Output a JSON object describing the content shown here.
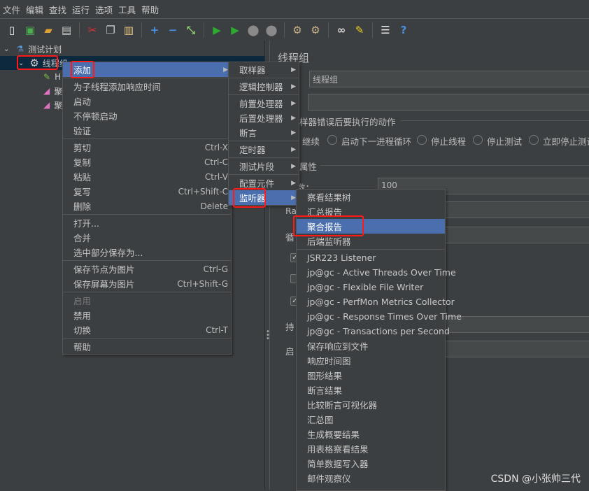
{
  "menubar": [
    "文件",
    "编辑",
    "查找",
    "运行",
    "选项",
    "工具",
    "帮助"
  ],
  "toolbar": [
    {
      "icon": "new-icon",
      "glyph": "▯",
      "color": "#eeeeee"
    },
    {
      "icon": "templates-icon",
      "glyph": "▣",
      "color": "#4caf50"
    },
    {
      "icon": "open-icon",
      "glyph": "▰",
      "color": "#e0a030"
    },
    {
      "icon": "save-icon",
      "glyph": "▤",
      "color": "#cccccc"
    },
    {
      "sep": true
    },
    {
      "icon": "cut-icon",
      "glyph": "✂",
      "color": "#e03030"
    },
    {
      "icon": "copy-icon",
      "glyph": "❐",
      "color": "#cccccc"
    },
    {
      "icon": "paste-icon",
      "glyph": "▥",
      "color": "#e0c080"
    },
    {
      "sep": true
    },
    {
      "icon": "expand-icon",
      "glyph": "+",
      "color": "#4a90e2"
    },
    {
      "icon": "collapse-icon",
      "glyph": "−",
      "color": "#4a90e2"
    },
    {
      "icon": "toggle-icon",
      "glyph": "⤡",
      "color": "#8fcf6f"
    },
    {
      "sep": true
    },
    {
      "icon": "start-icon",
      "glyph": "▶",
      "color": "#2eaa2e"
    },
    {
      "icon": "start-no-pause-icon",
      "glyph": "▶",
      "color": "#2eaa2e"
    },
    {
      "icon": "stop-icon",
      "glyph": "⬤",
      "color": "#8a8a8a"
    },
    {
      "icon": "shutdown-icon",
      "glyph": "⬤",
      "color": "#8a8a8a"
    },
    {
      "sep": true
    },
    {
      "icon": "clear-icon",
      "glyph": "⚙",
      "color": "#c9b28a"
    },
    {
      "icon": "clear-all-icon",
      "glyph": "⚙",
      "color": "#c9b28a"
    },
    {
      "sep": true
    },
    {
      "icon": "search-icon",
      "glyph": "∞",
      "color": "#dddddd"
    },
    {
      "icon": "reset-search-icon",
      "glyph": "✎",
      "color": "#f0d020"
    },
    {
      "sep": true
    },
    {
      "icon": "function-helper-icon",
      "glyph": "☰",
      "color": "#eeeeee"
    },
    {
      "icon": "help-icon",
      "glyph": "?",
      "color": "#4a90e2"
    }
  ],
  "tree": {
    "plan": "测试计划",
    "thread_group": "线程组",
    "child1": "H",
    "child2": "聚",
    "child3": "聚"
  },
  "context_menu": {
    "items": [
      {
        "label": "添加",
        "arrow": true,
        "selected": true
      },
      {
        "sep": true
      },
      {
        "label": "为子线程添加响应时间"
      },
      {
        "label": "启动"
      },
      {
        "label": "不停顿启动"
      },
      {
        "label": "验证"
      },
      {
        "sep": true
      },
      {
        "label": "剪切",
        "shortcut": "Ctrl-X"
      },
      {
        "label": "复制",
        "shortcut": "Ctrl-C"
      },
      {
        "label": "粘贴",
        "shortcut": "Ctrl-V"
      },
      {
        "label": "复写",
        "shortcut": "Ctrl+Shift-C"
      },
      {
        "label": "删除",
        "shortcut": "Delete"
      },
      {
        "sep": true
      },
      {
        "label": "打开..."
      },
      {
        "label": "合并"
      },
      {
        "label": "选中部分保存为..."
      },
      {
        "sep": true
      },
      {
        "label": "保存节点为图片",
        "shortcut": "Ctrl-G"
      },
      {
        "label": "保存屏幕为图片",
        "shortcut": "Ctrl+Shift-G"
      },
      {
        "sep": true
      },
      {
        "label": "启用",
        "disabled": true
      },
      {
        "label": "禁用"
      },
      {
        "label": "切换",
        "shortcut": "Ctrl-T"
      },
      {
        "sep": true
      },
      {
        "label": "帮助"
      }
    ]
  },
  "add_submenu": {
    "items": [
      {
        "label": "取样器",
        "arrow": true
      },
      {
        "sep": true
      },
      {
        "label": "逻辑控制器",
        "arrow": true
      },
      {
        "sep": true
      },
      {
        "label": "前置处理器",
        "arrow": true
      },
      {
        "label": "后置处理器",
        "arrow": true
      },
      {
        "label": "断言",
        "arrow": true
      },
      {
        "sep": true
      },
      {
        "label": "定时器",
        "arrow": true
      },
      {
        "sep": true
      },
      {
        "label": "测试片段",
        "arrow": true
      },
      {
        "sep": true
      },
      {
        "label": "配置元件",
        "arrow": true
      },
      {
        "label": "监听器",
        "arrow": true,
        "selected": true
      }
    ]
  },
  "listener_submenu": {
    "items": [
      {
        "label": "察看结果树"
      },
      {
        "label": "汇总报告"
      },
      {
        "label": "聚合报告",
        "selected": true
      },
      {
        "label": "后端监听器"
      },
      {
        "sep": true
      },
      {
        "label": "JSR223 Listener"
      },
      {
        "label": "jp@gc - Active Threads Over Time"
      },
      {
        "label": "jp@gc - Flexible File Writer"
      },
      {
        "label": "jp@gc - PerfMon Metrics Collector"
      },
      {
        "label": "jp@gc - Response Times Over Time"
      },
      {
        "label": "jp@gc - Transactions per Second"
      },
      {
        "label": "保存响应到文件"
      },
      {
        "label": "响应时间图"
      },
      {
        "label": "图形结果"
      },
      {
        "label": "断言结果"
      },
      {
        "label": "比较断言可视化器"
      },
      {
        "label": "汇总图"
      },
      {
        "label": "生成概要结果"
      },
      {
        "label": "用表格察看结果"
      },
      {
        "label": "简单数据写入器"
      },
      {
        "label": "邮件观察仪"
      }
    ]
  },
  "panel": {
    "title": "线程组",
    "name_value": "线程组",
    "comment_value": "",
    "error_action_label": "样器错误后要执行的动作",
    "radios": [
      "继续",
      "启动下一进程循环",
      "停止线程",
      "停止测试",
      "立即停止测试"
    ],
    "properties_label": "属性",
    "threads_label": "数：",
    "threads_value": "100",
    "ramp_label": "Ra",
    "loop_label": "循",
    "duration_label": "持",
    "delay_label": "启"
  },
  "accent_color": "#4b6eaf",
  "annotation_color": "#ff1a1a",
  "watermark": "CSDN @小张帅三代"
}
